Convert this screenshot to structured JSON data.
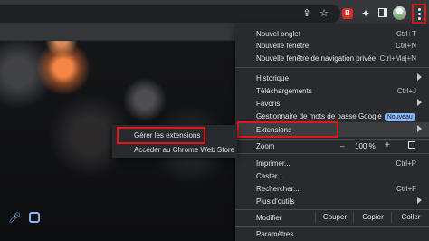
{
  "toolbar": {
    "icons": [
      "share-icon",
      "bookmark-star-icon",
      "extension-red-icon",
      "puzzle-extensions-icon",
      "side-panel-icon",
      "avatar",
      "more-menu-icon"
    ],
    "extension_letter": "B"
  },
  "menu": {
    "items": [
      {
        "label": "Nouvel onglet",
        "shortcut": "Ctrl+T"
      },
      {
        "label": "Nouvelle fenêtre",
        "shortcut": "Ctrl+N"
      },
      {
        "label": "Nouvelle fenêtre de navigation privée",
        "shortcut": "Ctrl+Maj+N"
      },
      {
        "label": "Historique",
        "shortcut": ""
      },
      {
        "label": "Téléchargements",
        "shortcut": "Ctrl+J"
      },
      {
        "label": "Favoris",
        "shortcut": ""
      },
      {
        "label": "Gestionnaire de mots de passe Google",
        "badge": "Nouveau"
      },
      {
        "label": "Extensions"
      },
      {
        "label": "Zoom",
        "zoom_minus": "–",
        "zoom_value": "100 %",
        "zoom_plus": "+"
      },
      {
        "label": "Imprimer...",
        "shortcut": "Ctrl+P"
      },
      {
        "label": "Caster...",
        "shortcut": ""
      },
      {
        "label": "Rechercher...",
        "shortcut": "Ctrl+F"
      },
      {
        "label": "Plus d'outils",
        "shortcut": ""
      },
      {
        "label": "Modifier",
        "buttons": [
          "Couper",
          "Copier",
          "Coller"
        ]
      },
      {
        "label": "Paramètres"
      }
    ]
  },
  "submenu": {
    "items": [
      "Gérer les extensions",
      "Accéder au Chrome Web Store"
    ]
  },
  "colors": {
    "highlight_box": "#e01818",
    "menu_bg": "#292a2d",
    "badge": "#8ab4f8"
  }
}
